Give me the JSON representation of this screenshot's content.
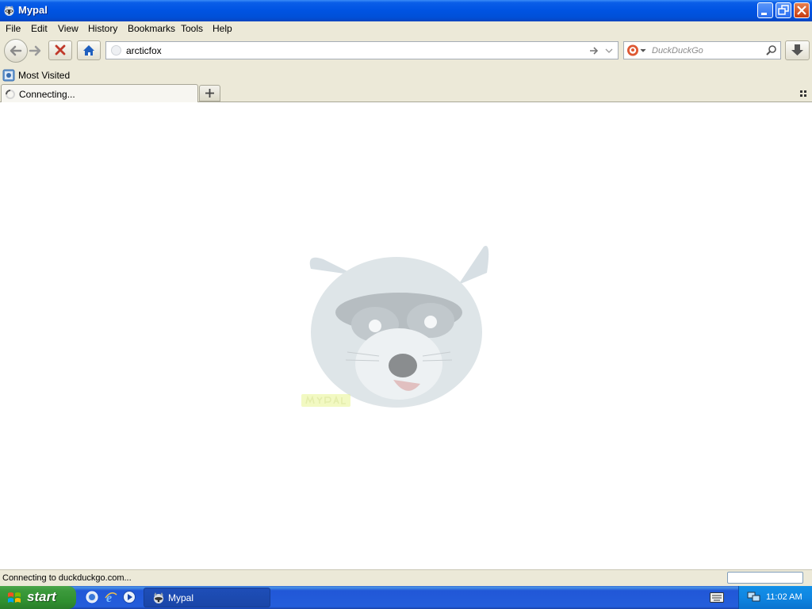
{
  "window": {
    "title": "Mypal"
  },
  "menu": {
    "items": [
      "File",
      "Edit",
      "View",
      "History",
      "Bookmarks",
      "Tools",
      "Help"
    ]
  },
  "navbar": {
    "url": "arcticfox",
    "search_placeholder": "DuckDuckGo"
  },
  "bookmarks": {
    "items": [
      "Most Visited"
    ]
  },
  "tabs": [
    {
      "label": "Connecting..."
    }
  ],
  "status": {
    "text": "Connecting to duckduckgo.com..."
  },
  "taskbar": {
    "start_label": "start",
    "task_label": "Mypal",
    "clock": "11:02 AM"
  },
  "colors": {
    "titlebar": "#0054e3",
    "chrome": "#ece9d8",
    "stop_icon": "#c0392b",
    "home_icon": "#1f5fbf",
    "start_button": "#3c9a3c",
    "taskbar": "#245edb"
  }
}
